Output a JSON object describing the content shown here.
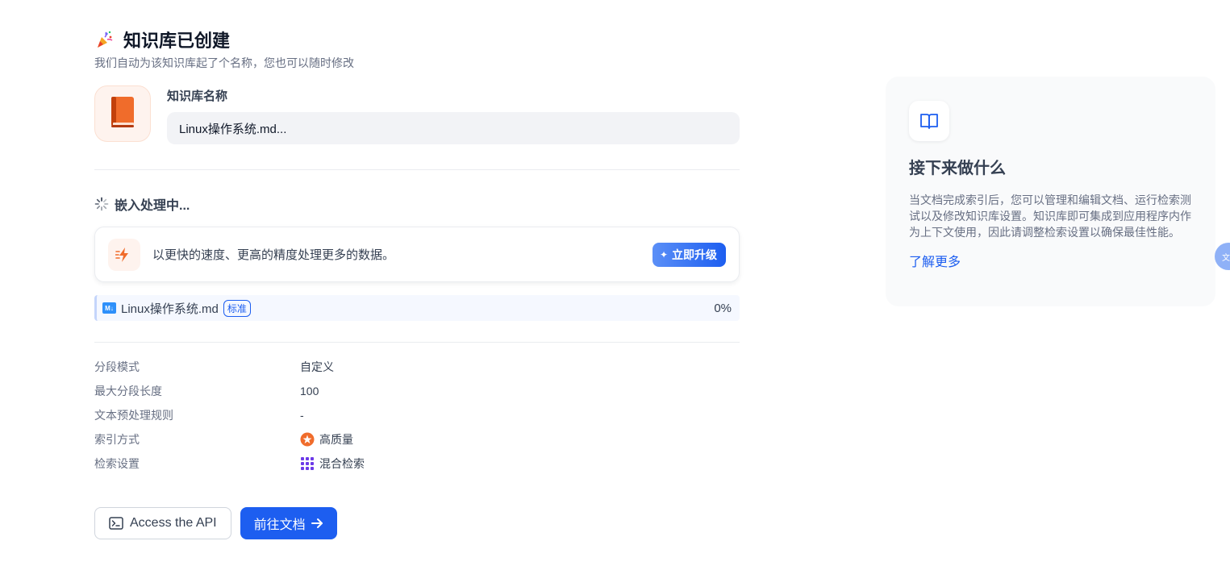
{
  "header": {
    "title": "知识库已创建",
    "subtitle": "我们自动为该知识库起了个名称，您也可以随时修改"
  },
  "knowledge": {
    "name_label": "知识库名称",
    "name_value": "Linux操作系统.md..."
  },
  "embedding": {
    "title": "嵌入处理中...",
    "upgrade_text": "以更快的速度、更高的精度处理更多的数据。",
    "upgrade_button": "立即升级",
    "file": {
      "name": "Linux操作系统.md",
      "badge": "标准",
      "progress": "0%"
    }
  },
  "settings": [
    {
      "key": "分段模式",
      "value": "自定义"
    },
    {
      "key": "最大分段长度",
      "value": "100"
    },
    {
      "key": "文本预处理规则",
      "value": "-"
    },
    {
      "key": "索引方式",
      "value": "高质量"
    },
    {
      "key": "检索设置",
      "value": "混合检索"
    }
  ],
  "actions": {
    "api_label": "Access the API",
    "docs_label": "前往文档"
  },
  "side": {
    "title": "接下来做什么",
    "text": "当文档完成索引后，您可以管理和编辑文档、运行检索测试以及修改知识库设置。知识库即可集成到应用程序内作为上下文使用，因此请调整检索设置以确保最佳性能。",
    "link": "了解更多"
  },
  "float_tab": {
    "label": "文"
  },
  "icons": {
    "title": "party-popper-icon",
    "avatar": "book-emoji-icon",
    "embed": "spinner-icon",
    "upgrade": "lightning-icon",
    "file": "markdown-icon",
    "index": "high-quality-icon",
    "retrieval": "grid-dots-icon",
    "api": "terminal-icon",
    "docs": "arrow-right-icon",
    "side": "open-book-icon"
  },
  "colors": {
    "primary": "#1d5ef0",
    "accent_orange": "#f06c2b",
    "purple": "#6d3ae8"
  }
}
